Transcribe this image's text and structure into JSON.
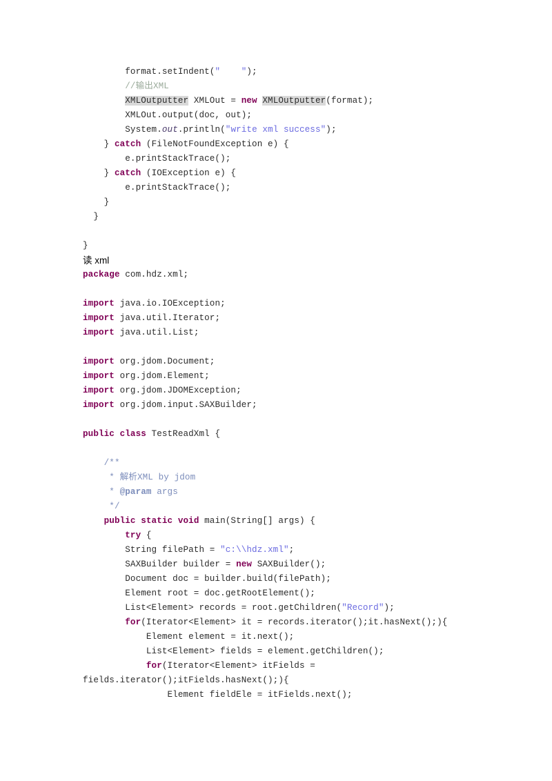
{
  "document": {
    "type": "code-listing",
    "language": "Java",
    "page_background": "#ffffff",
    "colors": {
      "keyword": "#7f0055",
      "string": "#6a6ae0",
      "comment": "#9aaa9a",
      "javadoc": "#7c8dbb",
      "plain_text": "#2b2b2b",
      "highlight_background": "#d9d9d9",
      "heading": "#000000"
    },
    "lines": [
      {
        "id": "l1",
        "kind": "code",
        "indent": 0,
        "text": "        format.setIndent(\"    \");"
      },
      {
        "id": "l2",
        "kind": "code",
        "indent": 0,
        "text": "        //输出XML"
      },
      {
        "id": "l3",
        "kind": "code",
        "indent": 0,
        "text": "        XMLOutputter XMLOut = new XMLOutputter(format);"
      },
      {
        "id": "l4",
        "kind": "code",
        "indent": 0,
        "text": "        XMLOut.output(doc, out);"
      },
      {
        "id": "l5",
        "kind": "code",
        "indent": 0,
        "text": "        System.out.println(\"write xml success\");"
      },
      {
        "id": "l6",
        "kind": "code",
        "indent": 0,
        "text": "    } catch (FileNotFoundException e) {"
      },
      {
        "id": "l7",
        "kind": "code",
        "indent": 0,
        "text": "        e.printStackTrace();"
      },
      {
        "id": "l8",
        "kind": "code",
        "indent": 0,
        "text": "    } catch (IOException e) {"
      },
      {
        "id": "l9",
        "kind": "code",
        "indent": 0,
        "text": "        e.printStackTrace();"
      },
      {
        "id": "l10",
        "kind": "code",
        "indent": 0,
        "text": "    }"
      },
      {
        "id": "l11",
        "kind": "code",
        "indent": 0,
        "text": "  }"
      },
      {
        "id": "l12",
        "kind": "blank",
        "indent": 0,
        "text": ""
      },
      {
        "id": "l13",
        "kind": "code",
        "indent": 0,
        "text": "}"
      },
      {
        "id": "l14",
        "kind": "heading",
        "indent": 0,
        "text": "读 xml"
      },
      {
        "id": "l15",
        "kind": "code",
        "indent": 0,
        "text": "package com.hdz.xml;"
      },
      {
        "id": "l16",
        "kind": "blank",
        "indent": 0,
        "text": ""
      },
      {
        "id": "l17",
        "kind": "code",
        "indent": 0,
        "text": "import java.io.IOException;"
      },
      {
        "id": "l18",
        "kind": "code",
        "indent": 0,
        "text": "import java.util.Iterator;"
      },
      {
        "id": "l19",
        "kind": "code",
        "indent": 0,
        "text": "import java.util.List;"
      },
      {
        "id": "l20",
        "kind": "blank",
        "indent": 0,
        "text": ""
      },
      {
        "id": "l21",
        "kind": "code",
        "indent": 0,
        "text": "import org.jdom.Document;"
      },
      {
        "id": "l22",
        "kind": "code",
        "indent": 0,
        "text": "import org.jdom.Element;"
      },
      {
        "id": "l23",
        "kind": "code",
        "indent": 0,
        "text": "import org.jdom.JDOMException;"
      },
      {
        "id": "l24",
        "kind": "code",
        "indent": 0,
        "text": "import org.jdom.input.SAXBuilder;"
      },
      {
        "id": "l25",
        "kind": "blank",
        "indent": 0,
        "text": ""
      },
      {
        "id": "l26",
        "kind": "code",
        "indent": 0,
        "text": "public class TestReadXml {"
      },
      {
        "id": "l27",
        "kind": "blank",
        "indent": 0,
        "text": ""
      },
      {
        "id": "l28",
        "kind": "code",
        "indent": 0,
        "text": "    /**"
      },
      {
        "id": "l29",
        "kind": "code",
        "indent": 0,
        "text": "     * 解析XML by jdom"
      },
      {
        "id": "l30",
        "kind": "code",
        "indent": 0,
        "text": "     * @param args"
      },
      {
        "id": "l31",
        "kind": "code",
        "indent": 0,
        "text": "     */"
      },
      {
        "id": "l32",
        "kind": "code",
        "indent": 0,
        "text": "    public static void main(String[] args) {"
      },
      {
        "id": "l33",
        "kind": "code",
        "indent": 0,
        "text": "        try {"
      },
      {
        "id": "l34",
        "kind": "code",
        "indent": 0,
        "text": "        String filePath = \"c:\\\\hdz.xml\";"
      },
      {
        "id": "l35",
        "kind": "code",
        "indent": 0,
        "text": "        SAXBuilder builder = new SAXBuilder();"
      },
      {
        "id": "l36",
        "kind": "code",
        "indent": 0,
        "text": "        Document doc = builder.build(filePath);"
      },
      {
        "id": "l37",
        "kind": "code",
        "indent": 0,
        "text": "        Element root = doc.getRootElement();"
      },
      {
        "id": "l38",
        "kind": "code",
        "indent": 0,
        "text": "        List<Element> records = root.getChildren(\"Record\");"
      },
      {
        "id": "l39",
        "kind": "code",
        "indent": 0,
        "text": "        for(Iterator<Element> it = records.iterator();it.hasNext();){"
      },
      {
        "id": "l40",
        "kind": "code",
        "indent": 0,
        "text": "            Element element = it.next();"
      },
      {
        "id": "l41",
        "kind": "code",
        "indent": 0,
        "text": "            List<Element> fields = element.getChildren();"
      },
      {
        "id": "l42",
        "kind": "code",
        "indent": 0,
        "text": "            for(Iterator<Element> itFields ="
      },
      {
        "id": "l43",
        "kind": "code",
        "indent": 0,
        "text": "fields.iterator();itFields.hasNext();){"
      },
      {
        "id": "l44",
        "kind": "code",
        "indent": 0,
        "text": "                Element fieldEle = itFields.next();"
      }
    ],
    "keywords_bold": [
      "new",
      "catch",
      "package",
      "import",
      "public",
      "class",
      "static",
      "void",
      "try",
      "for"
    ],
    "highlighted_tokens": [
      "XMLOutputter"
    ],
    "string_literals": [
      "\"    \"",
      "\"write xml success\"",
      "\"c:\\\\hdz.xml\"",
      "\"Record\""
    ],
    "comments": [
      "//输出XML"
    ],
    "javadoc_block": [
      "/**",
      "* 解析XML by jdom",
      "* @param args",
      "*/"
    ]
  }
}
